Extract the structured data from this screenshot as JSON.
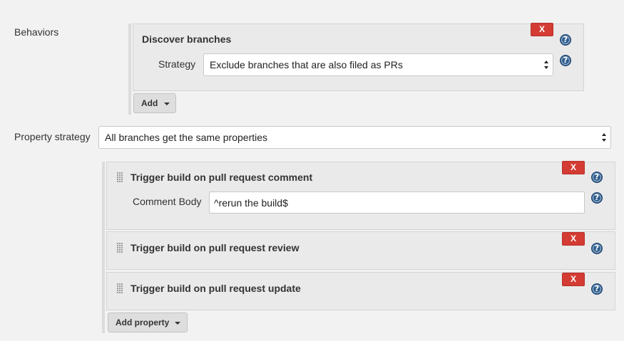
{
  "behaviors": {
    "label": "Behaviors",
    "discover_branches": {
      "title": "Discover branches",
      "delete_label": "X",
      "strategy_label": "Strategy",
      "strategy_value": "Exclude branches that are also filed as PRs"
    },
    "add_label": "Add"
  },
  "property_strategy": {
    "label": "Property strategy",
    "value": "All branches get the same properties",
    "properties": [
      {
        "title": "Trigger build on pull request comment",
        "delete_label": "X",
        "field_label": "Comment Body",
        "field_value": "^rerun the build$"
      },
      {
        "title": "Trigger build on pull request review",
        "delete_label": "X"
      },
      {
        "title": "Trigger build on pull request update",
        "delete_label": "X"
      }
    ],
    "add_property_label": "Add property"
  },
  "colors": {
    "delete_button": "#d33b33",
    "help_icon": "#2e5d8e",
    "panel_background": "#eaeaea",
    "page_background": "#f2f2f2"
  },
  "icons": [
    "help-icon",
    "drag-handle-icon",
    "dropdown-caret-icon",
    "select-arrows-icon"
  ]
}
